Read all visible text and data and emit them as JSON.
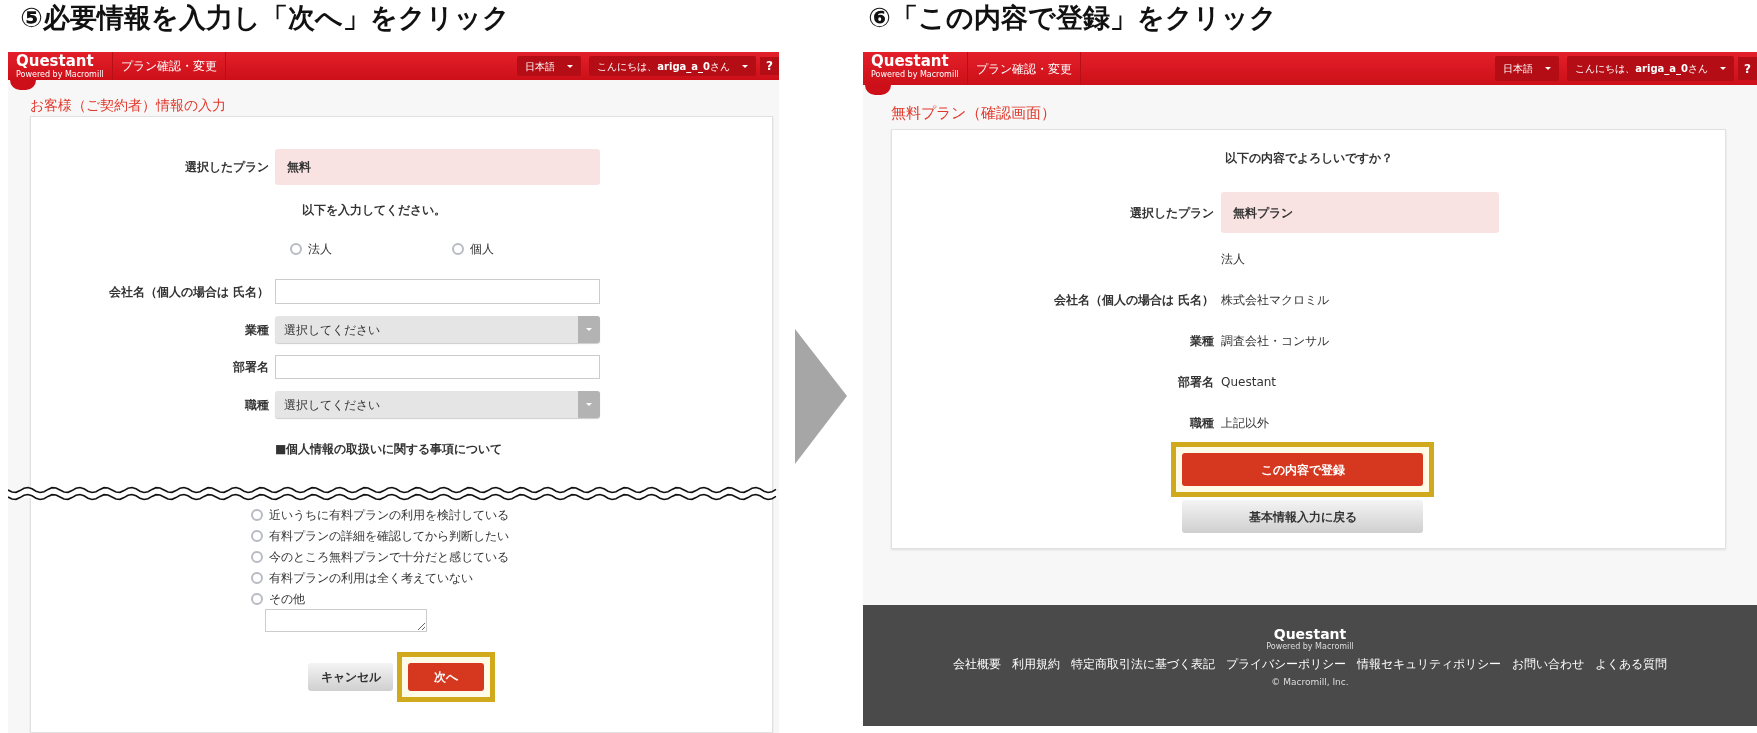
{
  "step5": {
    "caption": "⑤必要情報を入力し「次へ」をクリック",
    "header": {
      "logo": "Questant",
      "logo_sub": "Powered by Macromill",
      "nav": "プラン確認・変更",
      "language": "日本語",
      "greeting": "こんにちは、**ariga_a_0**さん",
      "help": "?"
    },
    "page_title": "お客様（ご契約者）情報の入力",
    "plan": {
      "label": "選択したプラン",
      "value": "無料"
    },
    "instruction": "以下を入力してください。",
    "entity_options": [
      {
        "label": "法人",
        "selected": false
      },
      {
        "label": "個人",
        "selected": false
      }
    ],
    "fields": [
      {
        "kind": "text",
        "label": "会社名（個人の場合は 氏名）"
      },
      {
        "kind": "select",
        "label": "業種",
        "value": "選択してください"
      },
      {
        "kind": "text",
        "label": "部署名"
      },
      {
        "kind": "select",
        "label": "職種",
        "value": "選択してください"
      }
    ],
    "privacy_heading": "■個人情報の取扱いに関する事項について",
    "survey_options": [
      {
        "label": "近いうちに有料プランの利用を検討している",
        "selected": false
      },
      {
        "label": "有料プランの詳細を確認してから判断したい",
        "selected": false
      },
      {
        "label": "今のところ無料プランで十分だと感じている",
        "selected": false
      },
      {
        "label": "有料プランの利用は全く考えていない",
        "selected": false
      },
      {
        "label": "その他",
        "selected": false
      }
    ],
    "buttons": [
      {
        "kind": "secondary",
        "label": "キャンセル",
        "highlighted": false
      },
      {
        "kind": "primary",
        "label": "次へ",
        "highlighted": true
      }
    ]
  },
  "step6": {
    "caption": "⑥「この内容で登録」をクリック",
    "header": {
      "logo": "Questant",
      "logo_sub": "Powered by Macromill",
      "nav": "プラン確認・変更",
      "language": "日本語",
      "greeting": "こんにちは、**ariga_a_0**さん",
      "help": "?"
    },
    "page_title": "無料プラン（確認画面）",
    "question": "以下の内容でよろしいですか？",
    "plan": {
      "label": "選択したプラン",
      "value": "無料プラン"
    },
    "details": [
      {
        "value": "法人"
      },
      {
        "label": "会社名（個人の場合は 氏名）",
        "value": "株式会社マクロミル"
      },
      {
        "label": "業種",
        "value": "調査会社・コンサル"
      },
      {
        "label": "部署名",
        "value": "Questant"
      },
      {
        "label": "職種",
        "value": "上記以外"
      }
    ],
    "buttons": [
      {
        "kind": "primary",
        "label": "この内容で登録",
        "highlighted": true
      },
      {
        "kind": "secondary",
        "label": "基本情報入力に戻る",
        "highlighted": false
      }
    ],
    "footer": {
      "logo": "Questant",
      "logo_sub": "Powered by Macromill",
      "links": [
        "会社概要",
        "利用規約",
        "特定商取引法に基づく表記",
        "プライバシーポリシー",
        "情報セキュリティポリシー",
        "お問い合わせ",
        "よくある質問"
      ],
      "copyright": "© Macromill, Inc."
    }
  }
}
